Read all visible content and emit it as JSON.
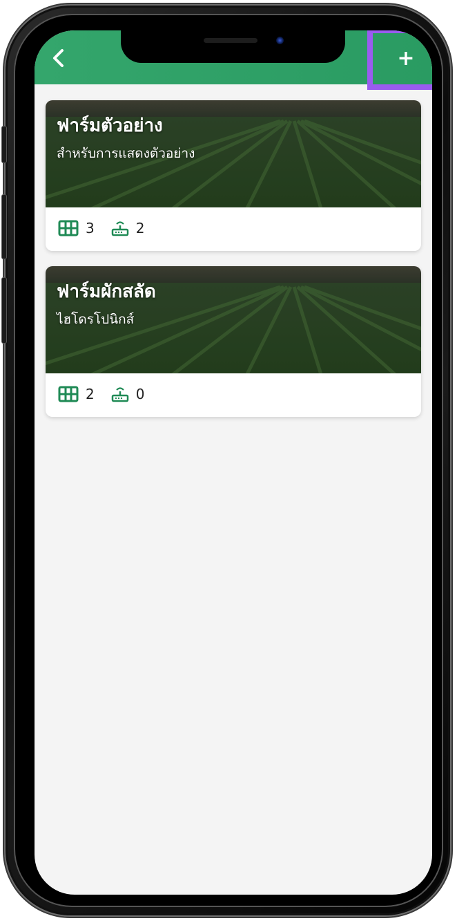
{
  "header": {
    "title": "",
    "back_icon": "chevron-left-icon",
    "add_label": "+"
  },
  "colors": {
    "header_green": "#2a9b62",
    "accent_green": "#1f8a55",
    "highlight": "#9a5cf0",
    "screen_bg": "#f4f4f4"
  },
  "farms": [
    {
      "name": "ฟาร์มตัวอย่าง",
      "description": "สำหรับการแสดงตัวอย่าง",
      "plots_icon": "grid-icon",
      "plots": "3",
      "devices_icon": "router-icon",
      "devices": "2"
    },
    {
      "name": "ฟาร์มผักสลัด",
      "description": "ไฮโดรโปนิกส์",
      "plots_icon": "grid-icon",
      "plots": "2",
      "devices_icon": "router-icon",
      "devices": "0"
    }
  ]
}
